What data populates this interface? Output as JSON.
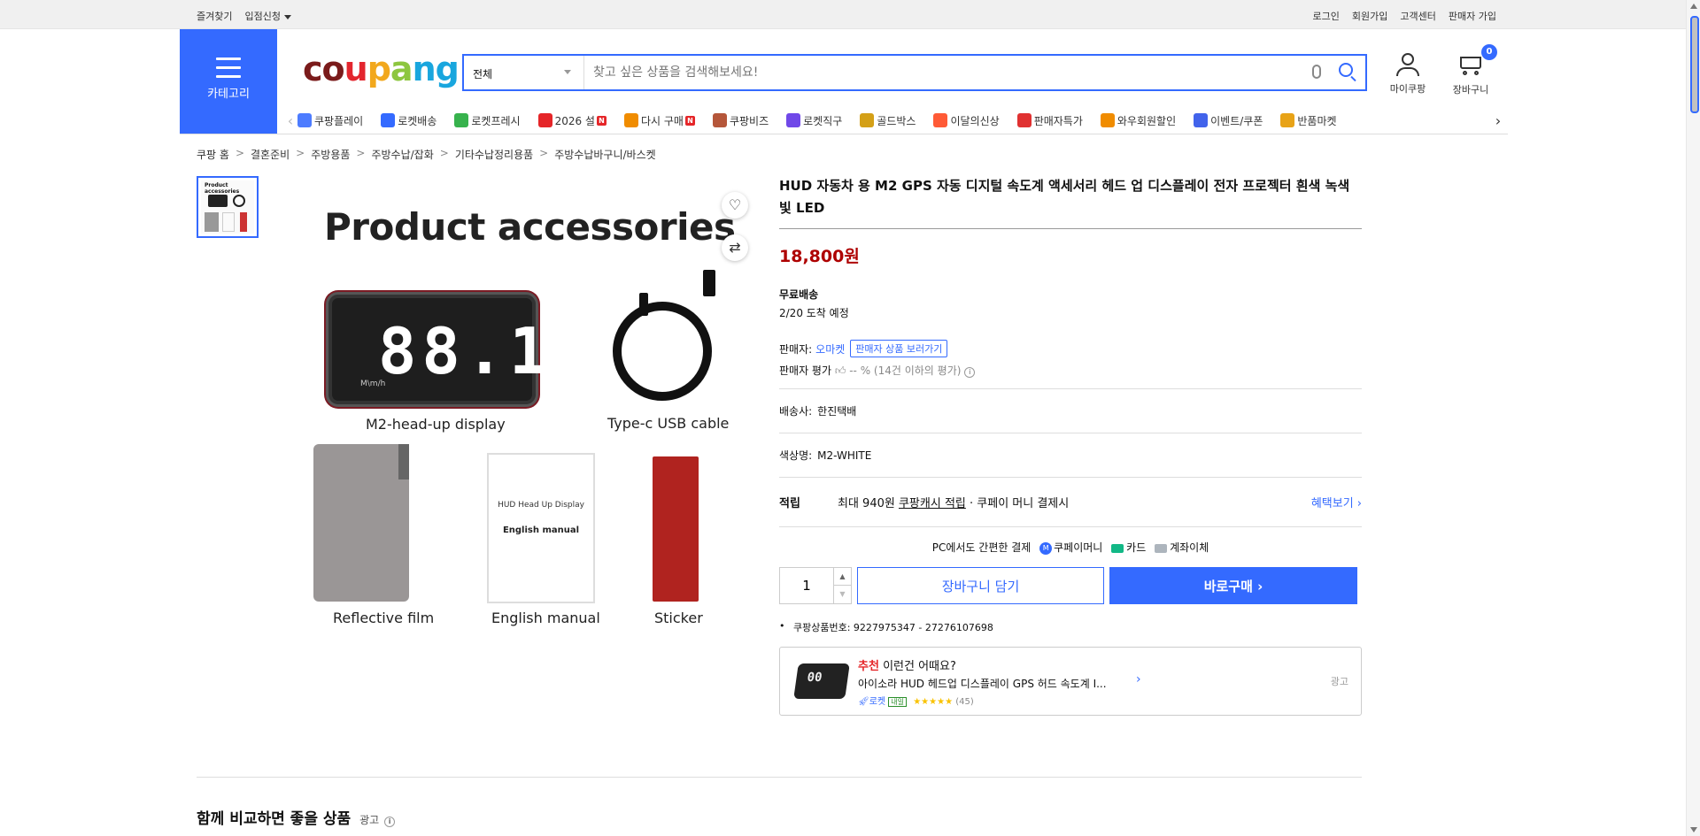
{
  "topbar": {
    "left": [
      "즐겨찾기",
      "입점신청"
    ],
    "right": [
      "로그인",
      "회원가입",
      "고객센터",
      "판매자 가입"
    ]
  },
  "header": {
    "category_label": "카테고리",
    "logo": [
      "c",
      "o",
      "u",
      "p",
      "a",
      "n",
      "g"
    ],
    "logo_colors": [
      "#7a1b1b",
      "#7a1b1b",
      "#e3262e",
      "#f2a81d",
      "#8dc63f",
      "#19a6de",
      "#19a6de"
    ],
    "search_category": "전체",
    "search_placeholder": "찾고 싶은 상품을 검색해보세요!",
    "mypage_label": "마이쿠팡",
    "cart_label": "장바구니",
    "cart_count": "0"
  },
  "quicknav": [
    {
      "label": "쿠팡플레이",
      "color": "#4d7cff",
      "badge": ""
    },
    {
      "label": "로켓배송",
      "color": "#346aff",
      "badge": ""
    },
    {
      "label": "로켓프레시",
      "color": "#37b24d",
      "badge": ""
    },
    {
      "label": "2026 설",
      "color": "#e52528",
      "badge": "N"
    },
    {
      "label": "다시 구매",
      "color": "#f08c00",
      "badge": "N"
    },
    {
      "label": "쿠팡비즈",
      "color": "#b5563a",
      "badge": ""
    },
    {
      "label": "로켓직구",
      "color": "#7048e8",
      "badge": ""
    },
    {
      "label": "골드박스",
      "color": "#d4a017",
      "badge": ""
    },
    {
      "label": "이달의신상",
      "color": "#ff5a36",
      "badge": ""
    },
    {
      "label": "판매자특가",
      "color": "#e03131",
      "badge": ""
    },
    {
      "label": "와우회원할인",
      "color": "#f08c00",
      "badge": ""
    },
    {
      "label": "이벤트/쿠폰",
      "color": "#4263eb",
      "badge": ""
    },
    {
      "label": "반품마켓",
      "color": "#e8a317",
      "badge": ""
    }
  ],
  "breadcrumb": [
    "쿠팡 홈",
    "결혼준비",
    "주방용품",
    "주방수납/잡화",
    "기타수납정리용품",
    "주방수납바구니/바스켓"
  ],
  "image": {
    "title": "Product accessories",
    "digits": "88.1",
    "hud_small": "M\\m/h",
    "labels": [
      "M2-head-up display",
      "Type-c  USB cable",
      "Reflective film",
      "English manual",
      "Sticker"
    ],
    "manual_line1": "HUD Head Up Display",
    "manual_line2": "English manual"
  },
  "product": {
    "title": "HUD 자동차 용 M2 GPS 자동 디지털 속도계 액세서리 헤드 업 디스플레이 전자 프로젝터 흰색 녹색 빛 LED",
    "price": "18,800원",
    "shipping_free": "무료배송",
    "shipping_date": "2/20 도착 예정",
    "seller_label": "판매자:",
    "seller_name": "오마켓",
    "seller_btn": "판매자 상품 보러가기",
    "rating_label": "판매자 평가",
    "rating_value": "-- % (14건 이하의 평가)",
    "courier_label": "배송사:",
    "courier": "한진택배",
    "color_label": "색상명:",
    "color": "M2-WHITE",
    "reward_label": "적립",
    "reward_text": "최대 940원",
    "reward_cash": "쿠팡캐시 적립",
    "reward_suffix": "· 쿠페이 머니 결제시",
    "reward_link": "혜택보기 ›",
    "pay_text": "PC에서도 간편한 결제",
    "pay_methods": [
      "쿠페이머니",
      "카드",
      "계좌이체"
    ],
    "quantity": "1",
    "cart_btn": "장바구니 담기",
    "buy_btn": "바로구매 ›",
    "product_id": "쿠팡상품번호: 9227975347 - 27276107698"
  },
  "recommend": {
    "badge": "추천",
    "title": "이런건 어때요?",
    "name": "아이소라 HUD 헤드업 디스플레이 GPS 허드 속도계 I...",
    "rocket": "로켓",
    "tomorrow": "내일",
    "stars": "★★★★★",
    "rating": 4.5,
    "count": "(45)",
    "ad": "광고"
  },
  "compare": {
    "title": "함께 비교하면 좋을 상품",
    "ad": "광고"
  }
}
